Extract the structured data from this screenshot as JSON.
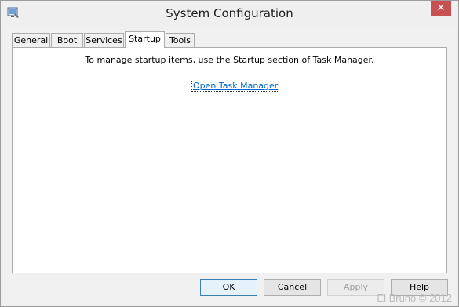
{
  "window": {
    "title": "System Configuration",
    "close_glyph": "✕"
  },
  "tabs": [
    {
      "label": "General",
      "active": false
    },
    {
      "label": "Boot",
      "active": false
    },
    {
      "label": "Services",
      "active": false
    },
    {
      "label": "Startup",
      "active": true
    },
    {
      "label": "Tools",
      "active": false
    }
  ],
  "startup": {
    "message": "To manage startup items, use the Startup section of Task Manager.",
    "link_label": "Open Task Manager"
  },
  "buttons": {
    "ok": "OK",
    "cancel": "Cancel",
    "apply": "Apply",
    "help": "Help"
  },
  "watermark": "El Bruno © 2012",
  "icons": {
    "app": "msconfig-icon",
    "close": "close-icon"
  },
  "colors": {
    "close_button": "#c75050",
    "link": "#0066cc",
    "default_button_border": "#3c7fb1"
  }
}
